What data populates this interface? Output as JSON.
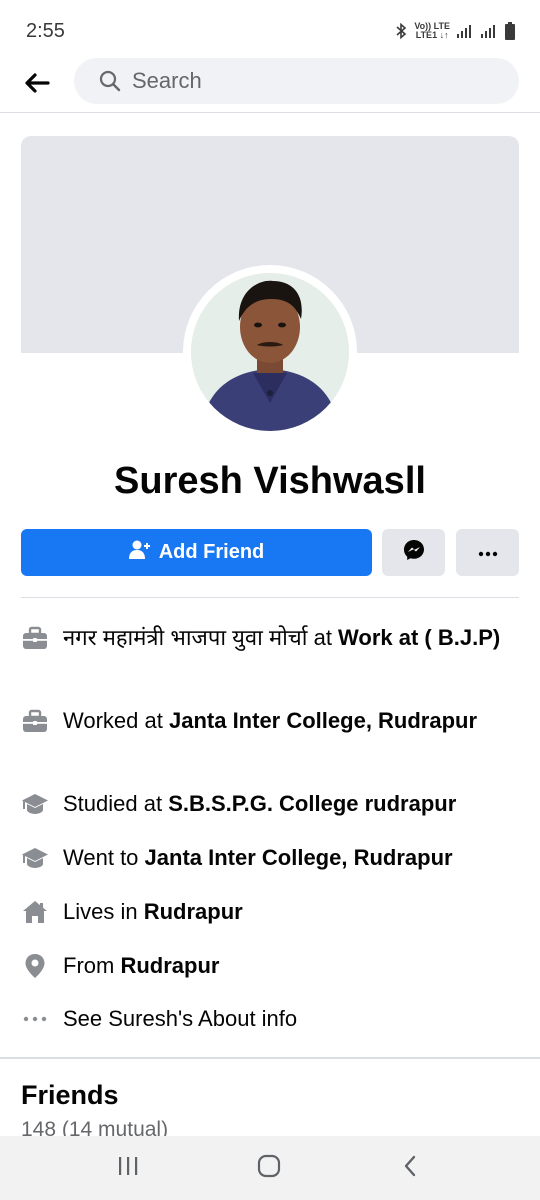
{
  "status_bar": {
    "time": "2:55",
    "lte_top": "Vo)) LTE",
    "lte_bottom": "LTE1 ↓↑"
  },
  "header": {
    "search_placeholder": "Search"
  },
  "profile": {
    "name": "Suresh Vishwasll",
    "add_friend_label": "Add Friend"
  },
  "intro": [
    {
      "icon": "briefcase-icon",
      "prefix": "नगर महामंत्री भाजपा युवा मोर्चा at ",
      "bold": "Work at ( B.J.P)"
    },
    {
      "icon": "briefcase-icon",
      "prefix": "Worked at ",
      "bold": "Janta Inter College, Rudrapur"
    },
    {
      "icon": "graduation-cap-icon",
      "prefix": "Studied at ",
      "bold": "S.B.S.P.G. College rudrapur"
    },
    {
      "icon": "graduation-cap-icon",
      "prefix": "Went to ",
      "bold": "Janta Inter College, Rudrapur"
    },
    {
      "icon": "home-icon",
      "prefix": "Lives in ",
      "bold": "Rudrapur"
    },
    {
      "icon": "location-pin-icon",
      "prefix": "From ",
      "bold": "Rudrapur"
    },
    {
      "icon": "more-dots-icon",
      "prefix": "See Suresh's About info",
      "bold": ""
    }
  ],
  "friends": {
    "title": "Friends",
    "count": "148 (14 mutual)"
  },
  "colors": {
    "accent": "#1877f2",
    "secondary_button": "#e4e6eb",
    "icon_gray": "#8a8d91"
  }
}
